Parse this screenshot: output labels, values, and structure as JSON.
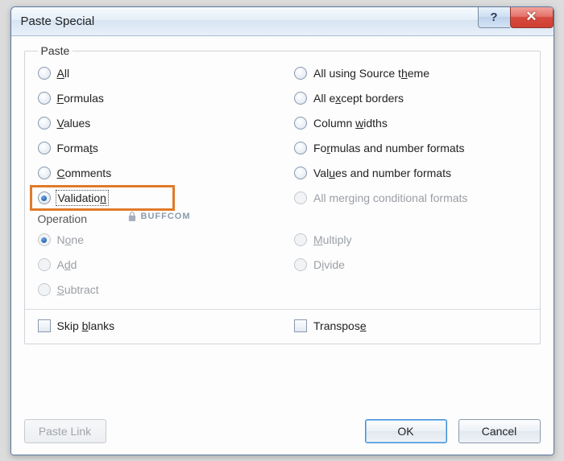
{
  "title": "Paste Special",
  "watermark": "BUFFCOM",
  "groups": {
    "paste": "Paste",
    "operation": "Operation"
  },
  "paste_left": [
    {
      "key": "all",
      "html": "<u>A</u>ll",
      "selected": false,
      "enabled": true
    },
    {
      "key": "formulas",
      "html": "<u>F</u>ormulas",
      "selected": false,
      "enabled": true
    },
    {
      "key": "values",
      "html": "<u>V</u>alues",
      "selected": false,
      "enabled": true
    },
    {
      "key": "formats",
      "html": "Forma<u>t</u>s",
      "selected": false,
      "enabled": true
    },
    {
      "key": "comments",
      "html": "<u>C</u>omments",
      "selected": false,
      "enabled": true
    },
    {
      "key": "validation",
      "html": "Validatio<u>n</u>",
      "selected": true,
      "enabled": true,
      "highlight": true
    }
  ],
  "paste_right": [
    {
      "key": "all-source-theme",
      "html": "All using Source t<u>h</u>eme",
      "selected": false,
      "enabled": true
    },
    {
      "key": "all-except-borders",
      "html": "All e<u>x</u>cept borders",
      "selected": false,
      "enabled": true
    },
    {
      "key": "column-widths",
      "html": "Column <u>w</u>idths",
      "selected": false,
      "enabled": true
    },
    {
      "key": "formulas-number-formats",
      "html": "Fo<u>r</u>mulas and number formats",
      "selected": false,
      "enabled": true
    },
    {
      "key": "values-number-formats",
      "html": "Val<u>u</u>es and number formats",
      "selected": false,
      "enabled": true
    },
    {
      "key": "merge-conditional",
      "html": "All merging conditional formats",
      "selected": false,
      "enabled": false
    }
  ],
  "op_left": [
    {
      "key": "none",
      "html": "N<u>o</u>ne",
      "selected": true,
      "enabled": false
    },
    {
      "key": "add",
      "html": "A<u>d</u>d",
      "selected": false,
      "enabled": false
    },
    {
      "key": "subtract",
      "html": "<u>S</u>ubtract",
      "selected": false,
      "enabled": false
    }
  ],
  "op_right": [
    {
      "key": "multiply",
      "html": "<u>M</u>ultiply",
      "selected": false,
      "enabled": false
    },
    {
      "key": "divide",
      "html": "D<u>i</u>vide",
      "selected": false,
      "enabled": false
    }
  ],
  "checks": {
    "skip_blanks": {
      "html": "Skip <u>b</u>lanks",
      "checked": false
    },
    "transpose": {
      "html": "Transpos<u>e</u>",
      "checked": false
    }
  },
  "buttons": {
    "paste_link": "Paste Link",
    "ok": "OK",
    "cancel": "Cancel"
  }
}
